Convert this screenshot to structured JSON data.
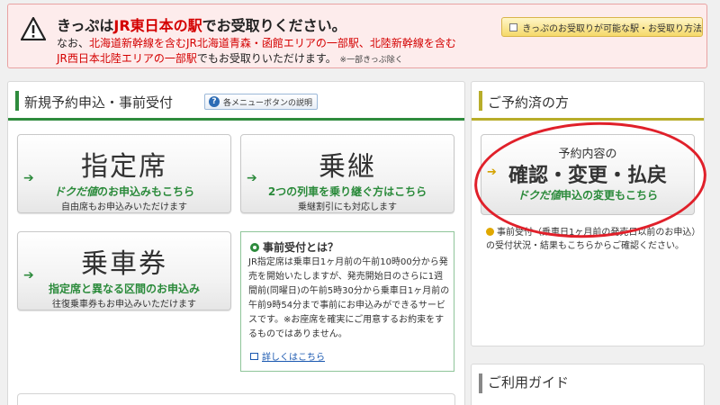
{
  "notice": {
    "line1_a": "きっぷは",
    "line1_b": "JR東日本の駅",
    "line1_c": "でお受取りください。",
    "line2_a": "なお、",
    "line2_b": "北海道新幹線を含むJR北海道青森・函館エリアの一部駅、北陸新幹線を含む",
    "line3_a": "JR西日本北陸エリアの一部駅",
    "line3_b": "でもお受取りいただけます。",
    "line3_note": "※一部きっぷ除く",
    "button_label": "きっぷのお受取りが可能な駅・お受取り方法"
  },
  "new_reservation": {
    "title": "新規予約申込・事前受付",
    "help_label": "各メニューボタンの説明",
    "reserved_seat": {
      "main": "指定席",
      "sub_brand": "ドクだ値",
      "sub_text": "のお申込みもこちら",
      "note": "自由席もお申込みいただけます"
    },
    "transfer": {
      "main": "乗継",
      "sub": "2つの列車を乗り継ぐ方はこちら",
      "note": "乗継割引にも対応します"
    },
    "ticket": {
      "main": "乗車券",
      "sub": "指定席と異なる区間のお申込み",
      "note": "往復乗車券もお申込みいただけます"
    },
    "advance": {
      "heading": "事前受付とは？",
      "body": "JR指定席は乗車日1ヶ月前の午前10時00分から発売を開始いたしますが、発売開始日のさらに1週間前(同曜日)の午前5時30分から乗車日1ヶ月前の午前9時54分まで事前にお申込みができるサービスです。※お座席を確実にご用意するお約束をするものではありません。",
      "more_link": "詳しくはこちら"
    }
  },
  "reserved": {
    "title": "ご予約済の方",
    "button_line1": "予約内容の",
    "button_line2": "確認・変更・払戻",
    "button_brand": "ドクだ値",
    "button_line3": "申込の変更もこちら",
    "note": "事前受付（乗車日1ヶ月前の発売日以前のお申込）の受付状況・結果もこちらからご確認ください。"
  },
  "guide": {
    "title": "ご利用ガイド"
  },
  "colors": {
    "accent_green": "#2e8b3d",
    "alert_red": "#d40000",
    "olive": "#b8ad2a",
    "highlight_ellipse": "#e0202a"
  }
}
